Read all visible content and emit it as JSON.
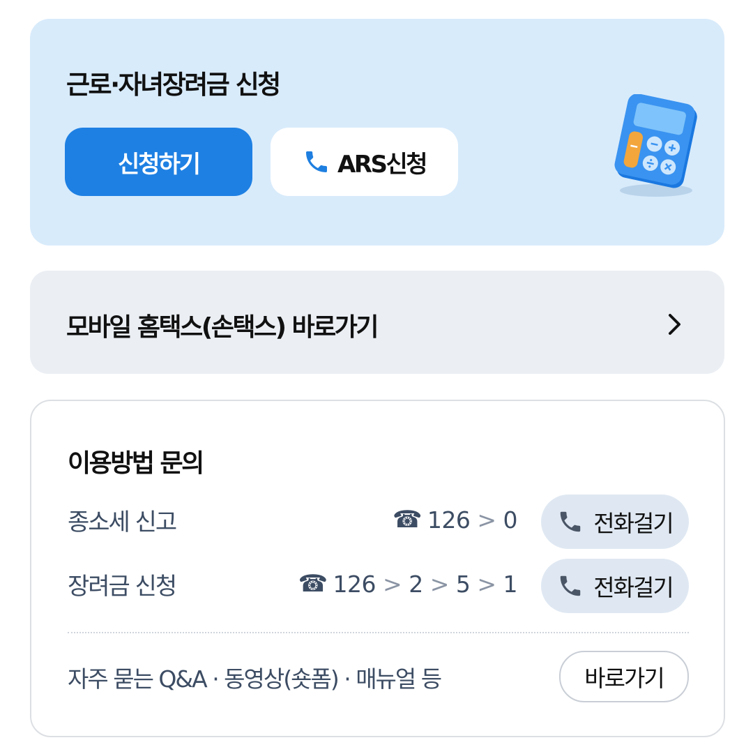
{
  "apply_card": {
    "title": "근로·자녀장려금 신청",
    "apply_button": "신청하기",
    "ars_button": "ARS신청"
  },
  "hometax": {
    "label": "모바일 홈택스(손택스) 바로가기"
  },
  "inquiry": {
    "title": "이용방법 문의",
    "rows": [
      {
        "label": "종소세 신고",
        "phone_symbol": "☎",
        "number_parts": [
          "126",
          "0"
        ],
        "call_button": "전화걸기"
      },
      {
        "label": "장려금 신청",
        "phone_symbol": "☎",
        "number_parts": [
          "126",
          "2",
          "5",
          "1"
        ],
        "call_button": "전화걸기"
      }
    ],
    "separator": ">",
    "faq_label": "자주 묻는 Q&A · 동영상(숏폼) · 매뉴얼 등",
    "goto_button": "바로가기"
  },
  "colors": {
    "primary": "#1e80e3",
    "apply_card_bg": "#d8ebfb",
    "hometax_bg": "#ebeff4",
    "call_button_bg": "#dfe8f2",
    "phone_icon": "#1e7fe0"
  },
  "icons": [
    "phone-icon",
    "calculator-icon",
    "chevron-right-icon",
    "phone-symbol-icon"
  ]
}
